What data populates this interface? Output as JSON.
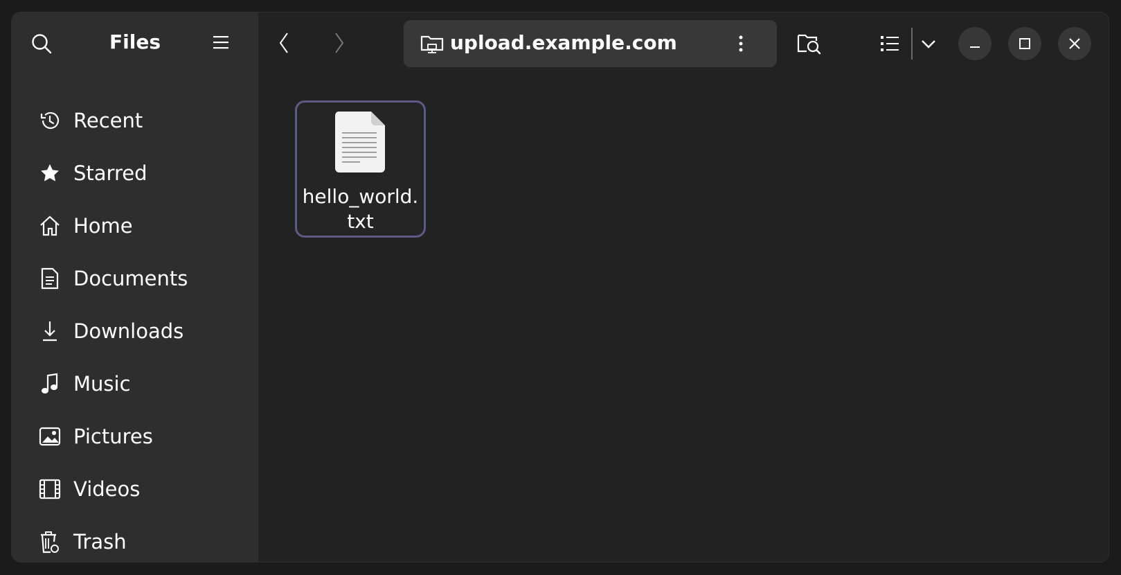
{
  "window": {
    "title": "Files"
  },
  "sidebar": {
    "items": [
      {
        "label": "Recent",
        "icon": "recent-clock-icon"
      },
      {
        "label": "Starred",
        "icon": "star-icon"
      },
      {
        "label": "Home",
        "icon": "home-icon"
      },
      {
        "label": "Documents",
        "icon": "document-icon"
      },
      {
        "label": "Downloads",
        "icon": "download-icon"
      },
      {
        "label": "Music",
        "icon": "music-note-icon"
      },
      {
        "label": "Pictures",
        "icon": "picture-icon"
      },
      {
        "label": "Videos",
        "icon": "film-icon"
      },
      {
        "label": "Trash",
        "icon": "trash-icon"
      }
    ]
  },
  "pathbar": {
    "location": "upload.example.com",
    "icon": "network-folder-icon"
  },
  "files": [
    {
      "name": "hello_world.txt",
      "display_line1": "hello_world.",
      "display_line2": "txt",
      "icon": "text-file-icon",
      "selected": true
    }
  ],
  "colors": {
    "sidebar_bg": "#2e2e2e",
    "content_bg": "#222222",
    "selection_border": "#5d5a86",
    "pathbar_bg": "#383838"
  }
}
